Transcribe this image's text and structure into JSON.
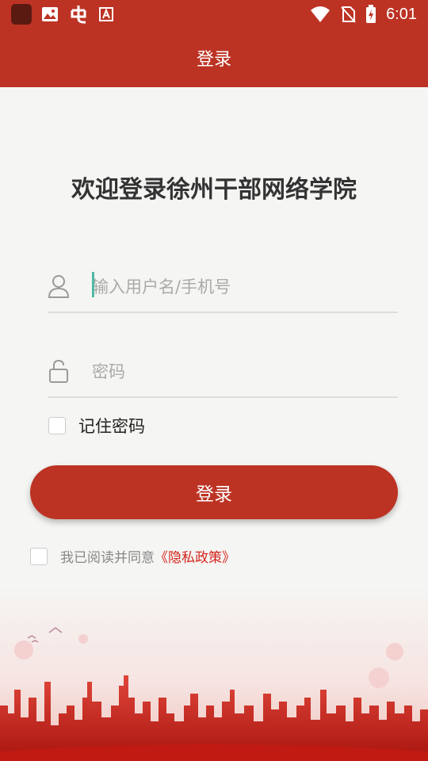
{
  "status_bar": {
    "time": "6:01",
    "icons": [
      "app-icon",
      "image-icon",
      "bug-icon",
      "a-icon",
      "wifi-icon",
      "no-sim-icon",
      "battery-icon"
    ]
  },
  "header": {
    "title": "登录"
  },
  "welcome_title": "欢迎登录徐州干部网络学院",
  "form": {
    "username_placeholder": "输入用户名/手机号",
    "password_placeholder": "密码",
    "remember_label": "记住密码",
    "login_button": "登录"
  },
  "agreement": {
    "text": "我已阅读并同意",
    "link": "《隐私政策》"
  },
  "colors": {
    "brand": "#bc3324",
    "link": "#d4261c",
    "caret": "#4fb9a0"
  }
}
